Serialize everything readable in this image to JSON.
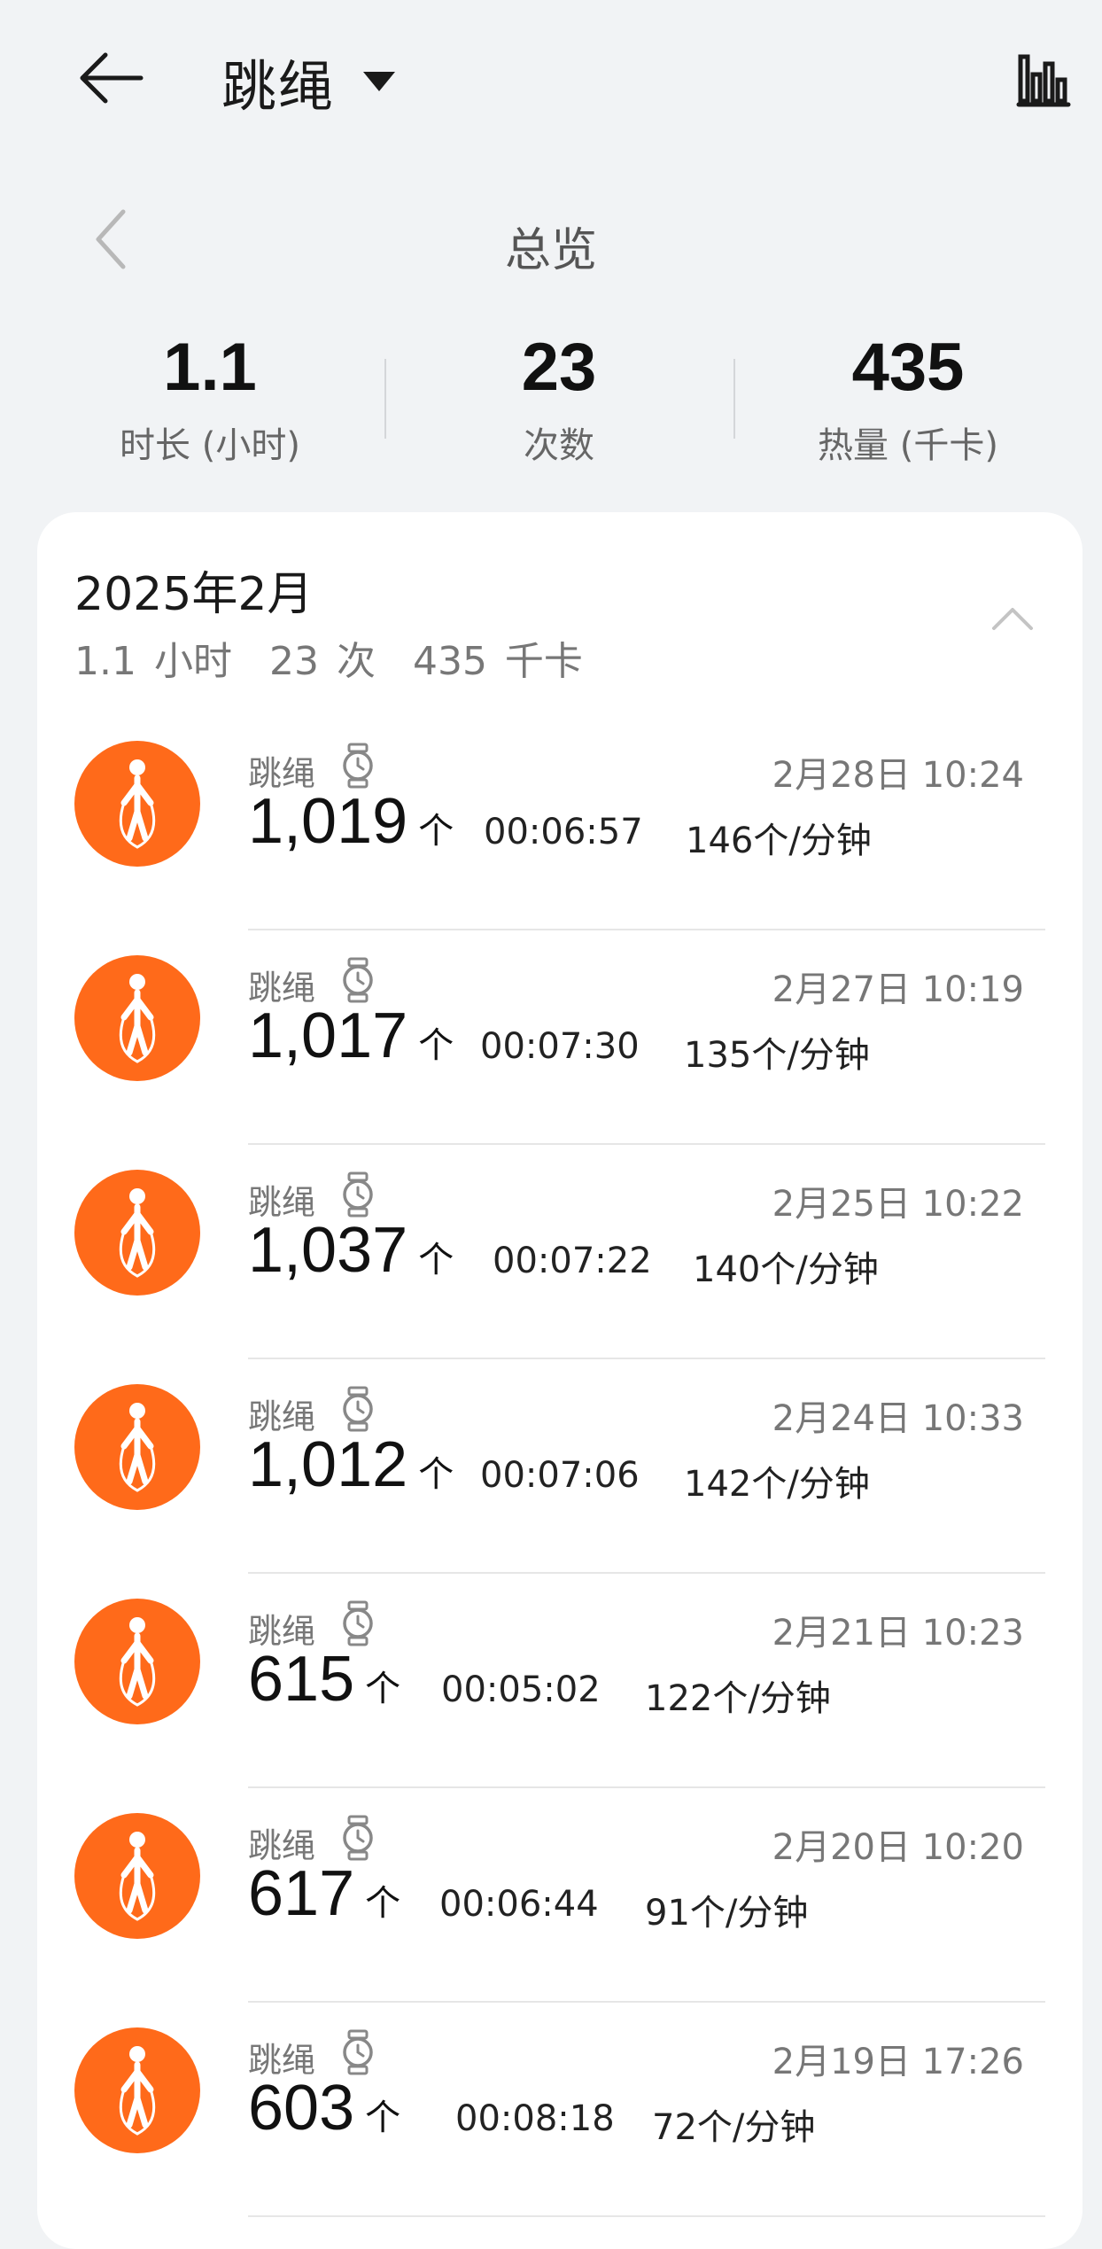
{
  "header": {
    "title": "跳绳",
    "back_icon": "arrow-left-icon",
    "dropdown_icon": "caret-down-icon",
    "stats_icon": "bar-chart-icon"
  },
  "overview": {
    "title": "总览",
    "prev_icon": "chevron-left-icon"
  },
  "summary": {
    "duration_value": "1.1",
    "duration_label": "时长 (小时)",
    "count_value": "23",
    "count_label": "次数",
    "calories_value": "435",
    "calories_label": "热量 (千卡)"
  },
  "month": {
    "title": "2025年2月",
    "hours": "1.1 小时",
    "sessions": "23 次",
    "calories": "435 千卡",
    "collapse_icon": "chevron-up-icon"
  },
  "colors": {
    "accent": "#ff6a1a",
    "background": "#f1f3f5",
    "card": "#ffffff"
  },
  "records": [
    {
      "name": "跳绳",
      "date": "2月28日 10:24",
      "count": "1,019",
      "unit": "个",
      "duration": "00:06:57",
      "rate": "146个/分钟"
    },
    {
      "name": "跳绳",
      "date": "2月27日 10:19",
      "count": "1,017",
      "unit": "个",
      "duration": "00:07:30",
      "rate": "135个/分钟"
    },
    {
      "name": "跳绳",
      "date": "2月25日 10:22",
      "count": "1,037",
      "unit": "个",
      "duration": "00:07:22",
      "rate": "140个/分钟"
    },
    {
      "name": "跳绳",
      "date": "2月24日 10:33",
      "count": "1,012",
      "unit": "个",
      "duration": "00:07:06",
      "rate": "142个/分钟"
    },
    {
      "name": "跳绳",
      "date": "2月21日 10:23",
      "count": "615",
      "unit": "个",
      "duration": "00:05:02",
      "rate": "122个/分钟"
    },
    {
      "name": "跳绳",
      "date": "2月20日 10:20",
      "count": "617",
      "unit": "个",
      "duration": "00:06:44",
      "rate": "91个/分钟"
    },
    {
      "name": "跳绳",
      "date": "2月19日 17:26",
      "count": "603",
      "unit": "个",
      "duration": "00:08:18",
      "rate": "72个/分钟"
    }
  ]
}
